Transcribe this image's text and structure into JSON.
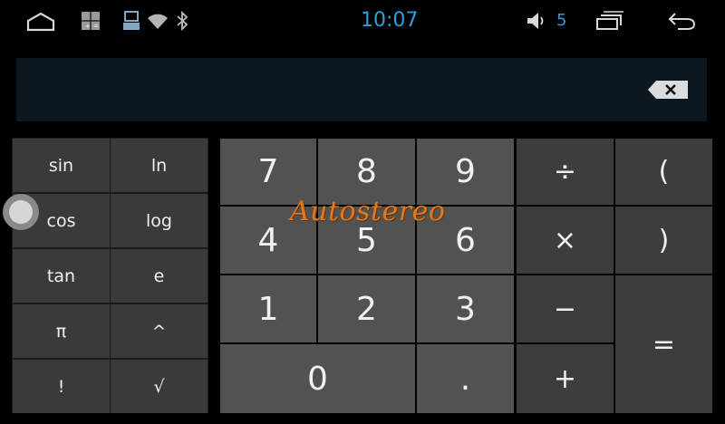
{
  "status_bar": {
    "time": "10:07",
    "volume_level": "5",
    "icons": [
      "home-icon",
      "multi-window-icon",
      "usb-device-icon",
      "wifi-icon",
      "bluetooth-icon",
      "volume-icon",
      "recent-apps-icon",
      "back-icon"
    ],
    "accent_color": "#2e9fd8"
  },
  "display": {
    "value": ""
  },
  "scientific_keys": [
    "sin",
    "ln",
    "cos",
    "log",
    "tan",
    "e",
    "π",
    "^",
    "!",
    "√"
  ],
  "numeric_keys": [
    "7",
    "8",
    "9",
    "4",
    "5",
    "6",
    "1",
    "2",
    "3",
    "0",
    "."
  ],
  "operator_keys": [
    "÷",
    "(",
    "×",
    ")",
    "−",
    "=",
    "+"
  ],
  "watermark": "Autostereo"
}
